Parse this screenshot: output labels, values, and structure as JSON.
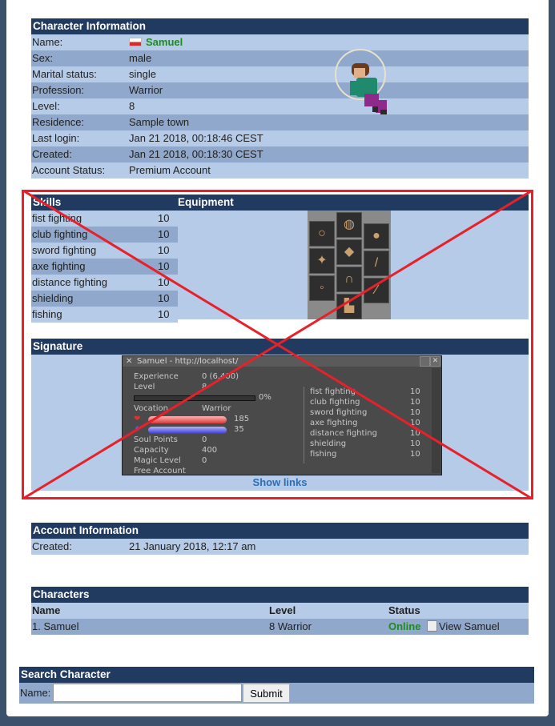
{
  "character_info": {
    "title": "Character Information",
    "rows": [
      {
        "label": "Name:",
        "value": "Samuel"
      },
      {
        "label": "Sex:",
        "value": "male"
      },
      {
        "label": "Marital status:",
        "value": "single"
      },
      {
        "label": "Profession:",
        "value": "Warrior"
      },
      {
        "label": "Level:",
        "value": "8"
      },
      {
        "label": "Residence:",
        "value": "Sample town"
      },
      {
        "label": "Last login:",
        "value": "Jan 21 2018, 00:18:46 CEST"
      },
      {
        "label": "Created:",
        "value": "Jan 21 2018, 00:18:30 CEST"
      },
      {
        "label": "Account Status:",
        "value": "Premium Account"
      }
    ]
  },
  "skills": {
    "title": "Skills",
    "items": [
      {
        "name": "fist fighting",
        "value": "10"
      },
      {
        "name": "club fighting",
        "value": "10"
      },
      {
        "name": "sword fighting",
        "value": "10"
      },
      {
        "name": "axe fighting",
        "value": "10"
      },
      {
        "name": "distance fighting",
        "value": "10"
      },
      {
        "name": "shielding",
        "value": "10"
      },
      {
        "name": "fishing",
        "value": "10"
      }
    ]
  },
  "equipment": {
    "title": "Equipment"
  },
  "signature": {
    "title": "Signature",
    "window_title": "Samuel - http://localhost/",
    "experience_label": "Experience",
    "experience_value": "0 (6,400)",
    "level_label": "Level",
    "level_value": "8",
    "progress_text": "0%",
    "vocation_label": "Vocation",
    "vocation_value": "Warrior",
    "health_value": "185",
    "mana_value": "35",
    "soul_label": "Soul Points",
    "soul_value": "0",
    "capacity_label": "Capacity",
    "capacity_value": "400",
    "magic_label": "Magic Level",
    "magic_value": "0",
    "account_text": "Free Account",
    "skills": [
      {
        "name": "fist fighting",
        "value": "10"
      },
      {
        "name": "club fighting",
        "value": "10"
      },
      {
        "name": "sword fighting",
        "value": "10"
      },
      {
        "name": "axe fighting",
        "value": "10"
      },
      {
        "name": "distance fighting",
        "value": "10"
      },
      {
        "name": "shielding",
        "value": "10"
      },
      {
        "name": "fishing",
        "value": "10"
      }
    ],
    "show_links": "Show links"
  },
  "account_info": {
    "title": "Account Information",
    "created_label": "Created:",
    "created_value": "21 January 2018, 12:17 am"
  },
  "characters": {
    "title": "Characters",
    "col_name": "Name",
    "col_level": "Level",
    "col_status": "Status",
    "rows": [
      {
        "name": "1. Samuel",
        "level": "8 Warrior",
        "status": "Online",
        "view": "View Samuel"
      }
    ]
  },
  "search": {
    "title": "Search Character",
    "name_label": "Name:",
    "submit": "Submit"
  },
  "colors": {
    "header": "#213a5f",
    "row_light": "#b6cbe8",
    "row_dark": "#8fa8cb",
    "online": "#1f8a1f",
    "overlay_cross": "#e8202a"
  }
}
